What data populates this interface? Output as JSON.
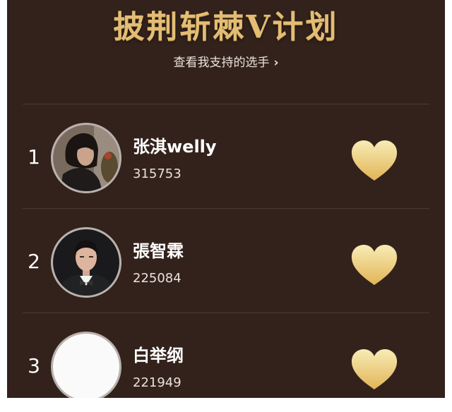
{
  "header": {
    "title": "披荆斩棘V计划",
    "sub_link_label": "查看我支持的选手",
    "sub_link_chevron": "›"
  },
  "ranking": [
    {
      "rank": "1",
      "name": "张淇welly",
      "votes": "315753",
      "avatar_icon": "photo-young-man-long-hair",
      "heart_icon": "heart-icon"
    },
    {
      "rank": "2",
      "name": "張智霖",
      "votes": "225084",
      "avatar_icon": "photo-man-bow-tie",
      "heart_icon": "heart-icon"
    },
    {
      "rank": "3",
      "name": "白举纲",
      "votes": "221949",
      "avatar_icon": "blank-avatar",
      "heart_icon": "heart-icon"
    }
  ],
  "colors": {
    "background": "#33221c",
    "title_gold": "#e3bd73",
    "heart_top": "#f7ecb6",
    "heart_bottom": "#e2b456",
    "divider": "#4c3a31"
  }
}
